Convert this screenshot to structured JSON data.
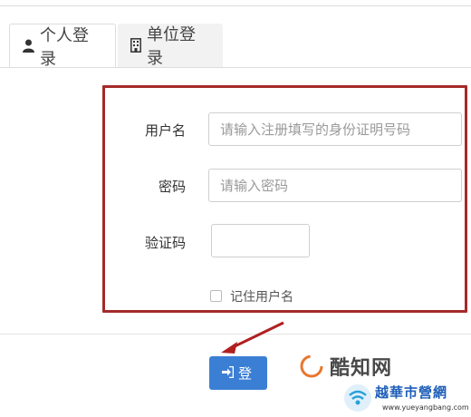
{
  "tabs": [
    {
      "label": "个人登录",
      "icon": "user-icon"
    },
    {
      "label": "单位登录",
      "icon": "building-icon"
    }
  ],
  "form": {
    "username_label": "用户名",
    "username_placeholder": "请输入注册填写的身份证明号码",
    "password_label": "密码",
    "password_placeholder": "请输入密码",
    "captcha_label": "验证码",
    "remember_label": "记住用户名"
  },
  "login_button": {
    "label": "登",
    "icon": "sign-in-icon"
  },
  "watermarks": {
    "primary": "酷知网",
    "secondary": "越華市營網",
    "secondary_url": "www.yueyangbang.com"
  },
  "colors": {
    "highlight_border": "#a52a2a",
    "button_blue": "#3b7fd4",
    "arrow_red": "#b02020"
  }
}
